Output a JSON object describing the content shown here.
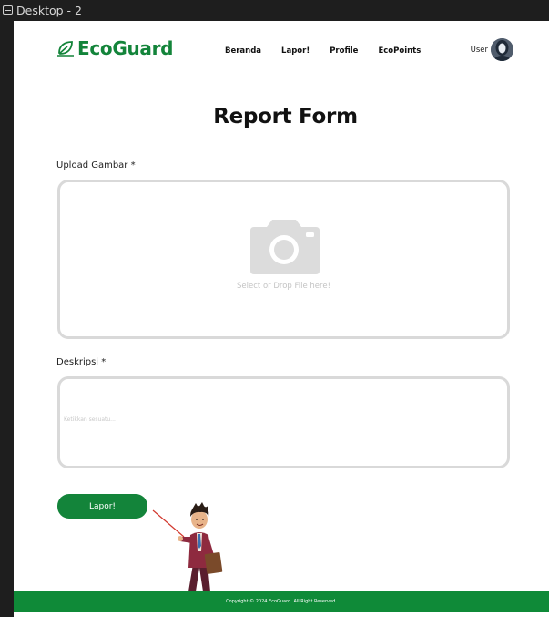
{
  "frame": {
    "title": "Desktop - 2"
  },
  "navbar": {
    "brand": "EcoGuard",
    "links": [
      "Beranda",
      "Lapor!",
      "Profile",
      "EcoPoints"
    ],
    "user_label": "User"
  },
  "page": {
    "title": "Report Form"
  },
  "form": {
    "upload_label": "Upload Gambar *",
    "upload_hint": "Select or  Drop File here!",
    "description_label": "Deskripsi *",
    "description_placeholder": "Ketikkan sesuatu...",
    "description_value": "",
    "submit_label": "Lapor!"
  },
  "footer": {
    "copyright": "Copyright © 2024 EcoGuard. All Right Reserved."
  },
  "colors": {
    "brand_green": "#13843a",
    "footer_green": "#0f8a38",
    "border_gray": "#d9d9d9"
  },
  "icons": [
    "frame-icon",
    "leaf-logo-icon",
    "user-avatar-icon",
    "camera-icon"
  ]
}
